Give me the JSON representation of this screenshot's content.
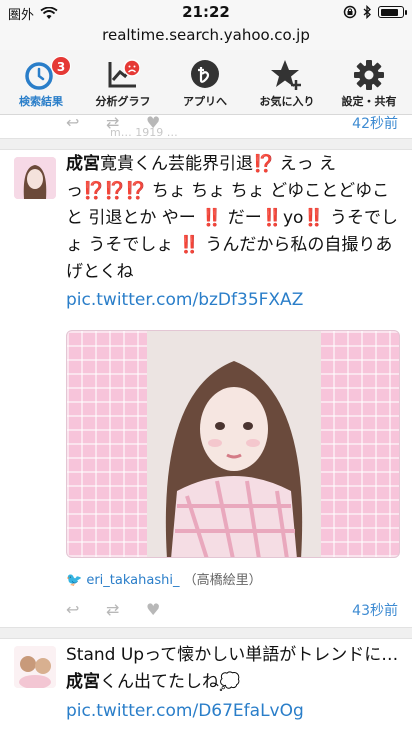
{
  "status_bar": {
    "carrier": "圏外",
    "time": "21:22"
  },
  "url": "realtime.search.yahoo.co.jp",
  "toolbar": {
    "items": [
      {
        "label": "検索結果",
        "icon": "clock-icon",
        "badge": "3",
        "active": true
      },
      {
        "label": "分析グラフ",
        "icon": "chart-icon"
      },
      {
        "label": "アプリへ",
        "icon": "app-icon"
      },
      {
        "label": "お気に入り",
        "icon": "star-plus-icon"
      },
      {
        "label": "設定・共有",
        "icon": "gear-icon"
      }
    ],
    "ghost_text": "m…  1919  …"
  },
  "feed": {
    "prev_time": "42秒前",
    "tweet1": {
      "text_name": "成宮",
      "text_rest1": "寛貴くん芸能界引退⁉️ えっ えっ⁉️⁉️⁉️ ちょ ちょ ちょ どゆことどゆこと 引退とか やー ‼️ だー‼️yo‼️ うそでしょ うそでしょ ‼️ うんだから私の自撮りあげとくね",
      "link": "pic.twitter.com/bzDf35FXAZ",
      "author_handle": "eri_takahashi_",
      "author_name": "（高橋絵里）",
      "time": "43秒前"
    },
    "tweet2": {
      "text_a": "Stand Upって懐かしい単語がトレンドに…",
      "text_name": "成宮",
      "text_b": "くん出てたしね💭",
      "link": "pic.twitter.com/D67EfaLvOg"
    }
  },
  "colors": {
    "accent": "#2a7ec9",
    "badge": "#e53935",
    "photo_bg": "#f7c4da"
  }
}
